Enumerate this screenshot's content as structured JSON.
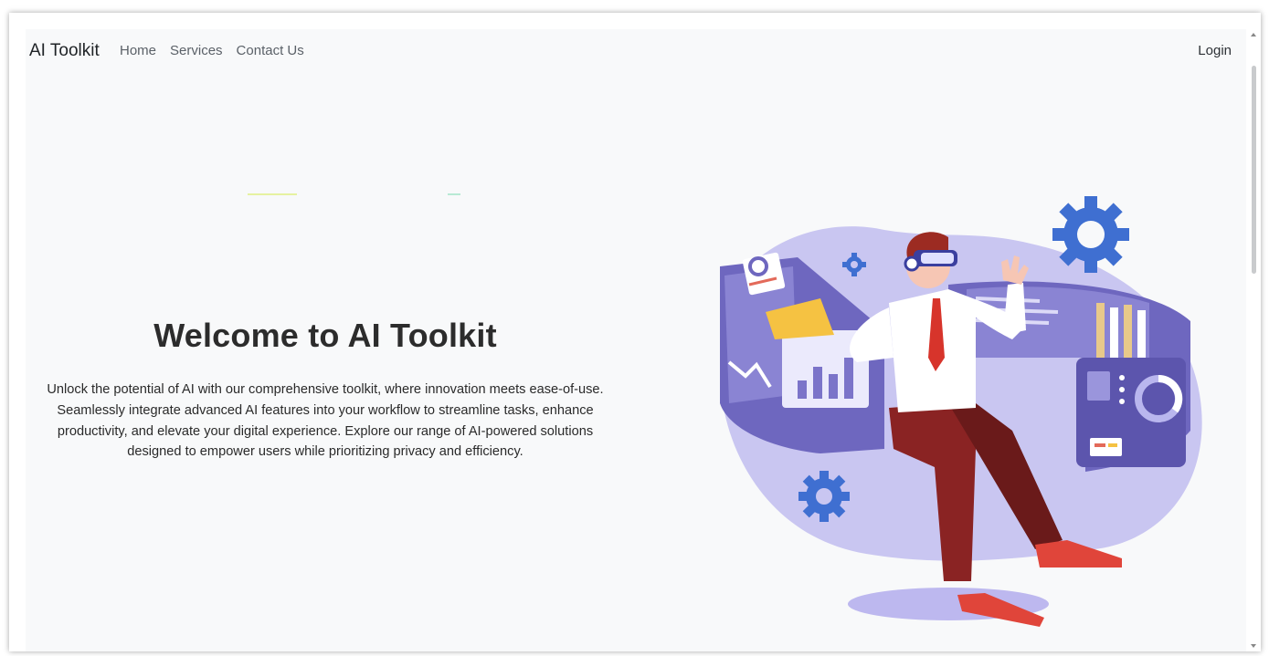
{
  "navbar": {
    "brand": "AI Toolkit",
    "links": [
      "Home",
      "Services",
      "Contact Us"
    ],
    "login": "Login"
  },
  "hero": {
    "title": "Welcome to AI Toolkit",
    "description": "Unlock the potential of AI with our comprehensive toolkit, where innovation meets ease-of-use. Seamlessly integrate advanced AI features into your workflow to streamline tasks, enhance productivity, and elevate your digital experience. Explore our range of AI-powered solutions designed to empower users while prioritizing privacy and efficiency."
  },
  "colors": {
    "background": "#f8f9fa",
    "accent_purple": "#7b74c9",
    "blob_lavender": "#c9c6f1",
    "gear_blue": "#3f6fd1",
    "tie_red": "#d7342b",
    "pants": "#7a1f1f"
  },
  "icons": [
    "gear-icon",
    "bar-chart-icon",
    "line-graph-icon",
    "vr-headset-icon"
  ]
}
